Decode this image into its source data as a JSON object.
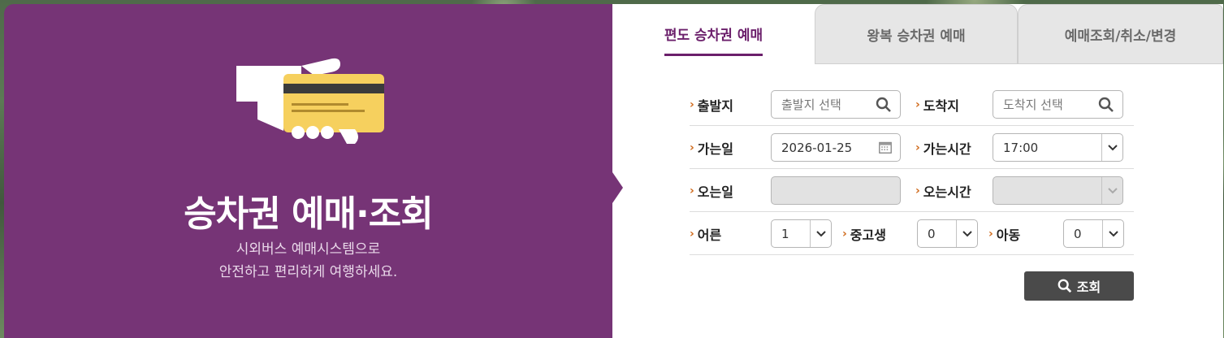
{
  "hero": {
    "title": "승차권 예매·조회",
    "subtitle_line1": "시외버스 예매시스템으로",
    "subtitle_line2": "안전하고 편리하게 여행하세요."
  },
  "tabs": [
    {
      "label": "편도 승차권 예매",
      "active": true
    },
    {
      "label": "왕복 승차권 예매",
      "active": false
    },
    {
      "label": "예매조회/취소/변경",
      "active": false
    }
  ],
  "form": {
    "departure": {
      "label": "출발지",
      "placeholder": "출발지 선택"
    },
    "arrival": {
      "label": "도착지",
      "placeholder": "도착지 선택"
    },
    "go_date": {
      "label": "가는일",
      "value": "2026-01-25"
    },
    "go_time": {
      "label": "가는시간",
      "value": "17:00"
    },
    "return_date": {
      "label": "오는일",
      "value": ""
    },
    "return_time": {
      "label": "오는시간",
      "value": ""
    },
    "adult": {
      "label": "어른",
      "value": "1"
    },
    "youth": {
      "label": "중고생",
      "value": "0"
    },
    "child": {
      "label": "아동",
      "value": "0"
    }
  },
  "search_button": {
    "label": "조회"
  },
  "colors": {
    "brand_purple": "#763476",
    "tab_accent": "#6b1f6b",
    "arrow_orange": "#d06a1c",
    "button_dark": "#4a4a4a"
  }
}
